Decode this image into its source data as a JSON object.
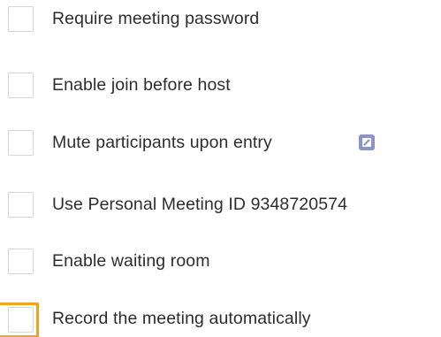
{
  "options": [
    {
      "label": "Require meeting password",
      "checked": false
    },
    {
      "label": "Enable join before host",
      "checked": false
    },
    {
      "label": "Mute participants upon entry",
      "checked": false,
      "info_icon": "info-icon"
    },
    {
      "label": "Use Personal Meeting ID 9348720574",
      "checked": false
    },
    {
      "label": "Enable waiting room",
      "checked": false
    },
    {
      "label": "Record the meeting automatically",
      "checked": false,
      "focused": true
    }
  ],
  "colors": {
    "text": "#2d2d2d",
    "checkbox_border": "#d6d6d6",
    "info_icon": "#8c93c9",
    "focus_highlight": "#f0a21d"
  }
}
